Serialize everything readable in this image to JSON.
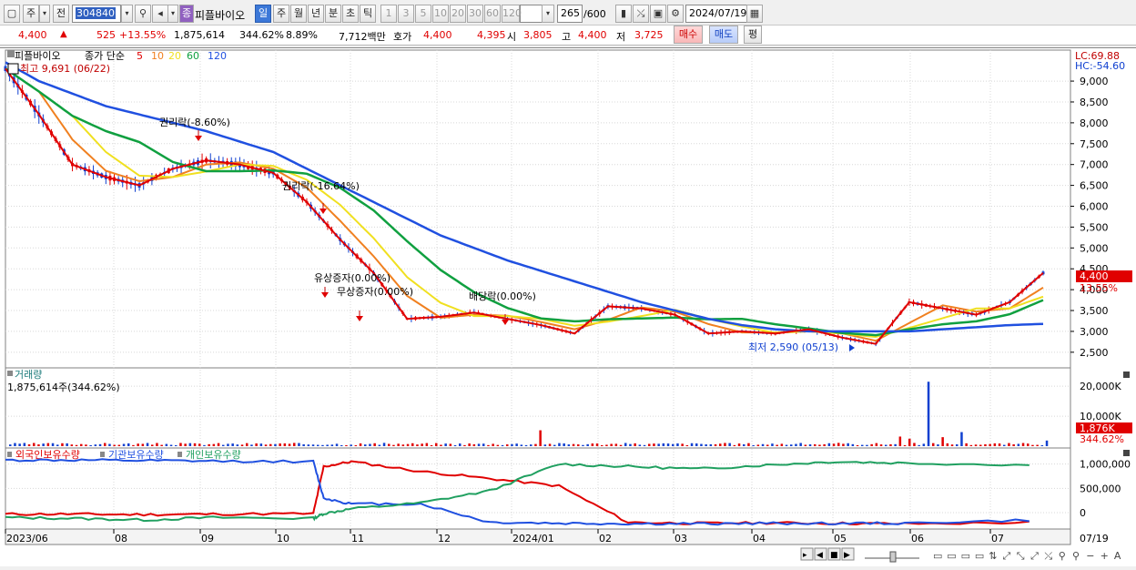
{
  "toolbar": {
    "market": "주",
    "prev": "전",
    "code": "304840",
    "stock_btn": "종",
    "stock_name": "피플바이오",
    "period_tabs": [
      "일",
      "주",
      "월",
      "년",
      "분",
      "초",
      "틱"
    ],
    "intervals": [
      "1",
      "3",
      "5",
      "10",
      "20",
      "30",
      "60",
      "120"
    ],
    "count": "265",
    "count_max": "/600",
    "date": "2024/07/19"
  },
  "quote": {
    "price": "4,400",
    "change": "525",
    "change_pct": "+13.55%",
    "volume": "1,875,614",
    "vol_ratio": "344.62%",
    "turnover": "8.89%",
    "amount": "7,712백만",
    "bid_label": "호가",
    "bid1": "4,400",
    "bid2": "4,395",
    "open_label": "시",
    "open": "3,805",
    "high_label": "고",
    "high": "4,400",
    "low_label": "저",
    "low": "3,725",
    "buy": "매수",
    "sell": "매도",
    "avg": "평"
  },
  "price_pane": {
    "legend_name": "피플바이오",
    "legend_type": "종가 단순",
    "ma": [
      "5",
      "10",
      "20",
      "60",
      "120"
    ],
    "high_note": "최고 9,691 (06/22)",
    "low_note": "최저 2,590 (05/13)",
    "lc": "LC:69.88",
    "hc": "HC:-54.60",
    "last": "4,400",
    "last_pct": "13.55%",
    "yticks": [
      "9,000",
      "8,500",
      "8,000",
      "7,500",
      "7,000",
      "6,500",
      "6,000",
      "5,500",
      "5,000",
      "4,500",
      "4,000",
      "3,500",
      "3,000",
      "2,500"
    ],
    "annotations": [
      "권리락(-8.60%)",
      "권리락(-16.64%)",
      "유상증자(0.00%)",
      "무상증자(0.00%)",
      "배당락(0.00%)"
    ]
  },
  "volume_pane": {
    "title": "거래량",
    "value": "1,875,614주(344.62%)",
    "yticks": [
      "20,000K",
      "10,000K"
    ],
    "last": "1,876K",
    "last_pct": "344.62%"
  },
  "holding_pane": {
    "series": [
      "외국인보유수량",
      "기관보유수량",
      "개인보유수량"
    ],
    "yticks": [
      "1,000,000",
      "500,000",
      "0"
    ]
  },
  "xaxis": {
    "labels": [
      "2023/06",
      "08",
      "09",
      "10",
      "11",
      "12",
      "2024/01",
      "02",
      "03",
      "04",
      "05",
      "06",
      "07"
    ],
    "end": "07/19"
  },
  "colors": {
    "ma5": "#e00000",
    "ma10": "#f08020",
    "ma20": "#f0e020",
    "ma60": "#10a040",
    "ma120": "#2050e0",
    "up": "#e00000",
    "down": "#1040d0"
  },
  "chart_data": [
    {
      "type": "line",
      "title": "",
      "series": [
        {
          "name": "5",
          "values": [
            9300,
            8200,
            7000,
            6700,
            6500,
            6900,
            7100,
            7000,
            6800,
            6100,
            5200,
            4400,
            3300,
            3350,
            3450,
            3300,
            3150,
            2950,
            3600,
            3550,
            3400,
            2950,
            3000,
            2950,
            3050,
            2850,
            2700,
            3700,
            3550,
            3400,
            3700,
            4400
          ]
        },
        {
          "name": "120",
          "values": [
            9450,
            9000,
            8700,
            8400,
            8200,
            8000,
            7800,
            7550,
            7300,
            6900,
            6500,
            6100,
            5700,
            5300,
            5000,
            4700,
            4450,
            4200,
            3950,
            3700,
            3500,
            3300,
            3150,
            3050,
            3000,
            3000,
            3000,
            3000,
            3050,
            3100,
            3150,
            3180
          ]
        }
      ],
      "x": [
        "2023/06",
        "",
        "08",
        "",
        "09",
        "",
        "10",
        "",
        "11",
        "",
        "12",
        "",
        "2024/01",
        "",
        "02",
        "",
        "03",
        "",
        "04",
        "",
        "05",
        "",
        "06",
        "",
        "07",
        "",
        "",
        "",
        "",
        "",
        "",
        "07/19"
      ],
      "ylim": [
        2300,
        9700
      ]
    },
    {
      "type": "bar",
      "title": "거래량",
      "values": [
        0.8,
        0.6,
        0.5,
        0.4,
        0.5,
        0.6,
        0.5,
        0.4,
        0.5,
        0.6,
        0.5,
        0.7,
        0.6,
        0.5,
        0.4,
        0.5,
        0.6,
        0.5,
        0.4,
        0.5,
        21.5,
        5.0,
        1.876
      ],
      "ylim": [
        0,
        24
      ]
    },
    {
      "type": "line",
      "series": [
        {
          "name": "외국인보유수량",
          "values": [
            -30000,
            -30000,
            -40000,
            -30000,
            -20000,
            950000,
            1050000,
            850000,
            700000,
            550000,
            -200000,
            -220000,
            -210000,
            -220000,
            -230000,
            -200000
          ]
        },
        {
          "name": "기관보유수량",
          "values": [
            1080000,
            1080000,
            1070000,
            1060000,
            1050000,
            300000,
            180000,
            180000,
            -200000,
            -220000,
            -230000,
            -230000,
            -220000,
            -220000,
            -220000,
            -150000
          ]
        },
        {
          "name": "개인보유수량",
          "values": [
            -100000,
            -120000,
            -150000,
            -100000,
            -120000,
            -20000,
            80000,
            200000,
            450000,
            1000000,
            950000,
            900000,
            980000,
            1050000,
            1020000,
            980000
          ]
        }
      ],
      "ylim": [
        -300000,
        1200000
      ]
    }
  ]
}
